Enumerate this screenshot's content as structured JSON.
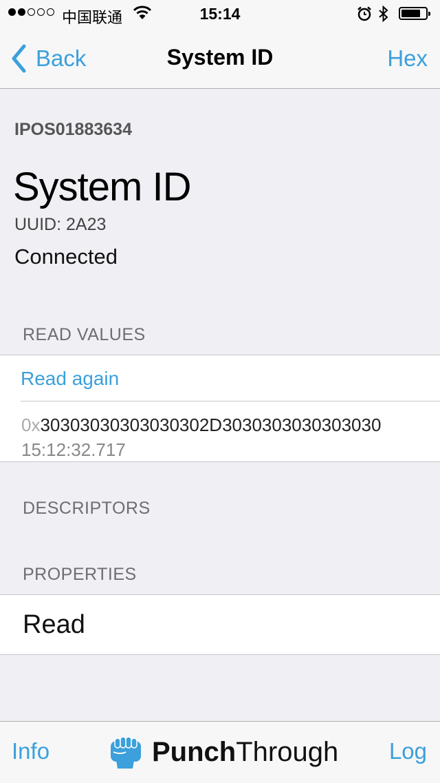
{
  "status_bar": {
    "carrier": "中国联通",
    "time": "15:14",
    "battery_level": 0.8
  },
  "nav": {
    "back_label": "Back",
    "title": "System ID",
    "right_label": "Hex"
  },
  "device": {
    "id": "IPOS01883634"
  },
  "characteristic": {
    "name": "System ID",
    "uuid": "UUID: 2A23",
    "connection_status": "Connected"
  },
  "read_values": {
    "header": "READ VALUES",
    "read_again_label": "Read again",
    "value_prefix": "0x",
    "value": "30303030303030302D3030303030303030",
    "timestamp": "15:12:32.717"
  },
  "descriptors": {
    "header": "DESCRIPTORS"
  },
  "properties": {
    "header": "PROPERTIES",
    "items": [
      "Read"
    ]
  },
  "tab_bar": {
    "left_label": "Info",
    "brand_bold": "Punch",
    "brand_regular": "Through",
    "right_label": "Log"
  },
  "colors": {
    "accent": "#3ba0dc",
    "background": "#efeff4"
  }
}
